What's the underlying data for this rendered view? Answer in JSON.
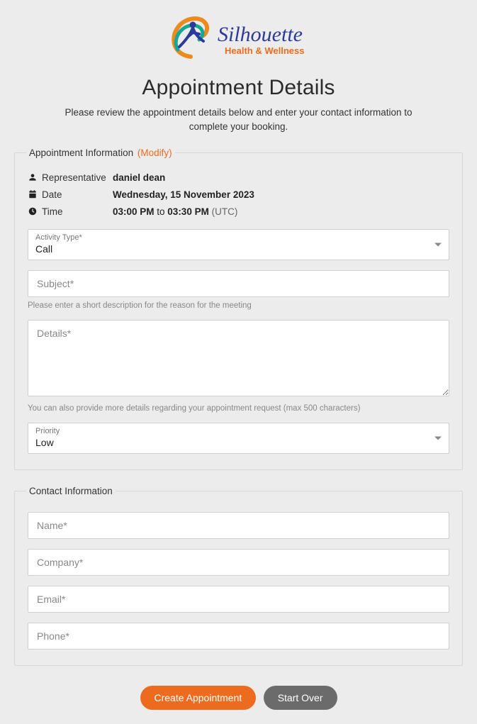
{
  "brand": {
    "name": "Silhouette",
    "tagline": "Health & Wellness"
  },
  "page": {
    "title": "Appointment Details",
    "subtitle": "Please review the appointment details below and enter your contact information to complete your booking."
  },
  "appointment_info": {
    "legend": "Appointment Information",
    "modify_link": "(Modify)",
    "representative_label": "Representative",
    "representative_value": "daniel dean",
    "date_label": "Date",
    "date_value": "Wednesday, 15 November 2023",
    "time_label": "Time",
    "time_start": "03:00 PM",
    "time_to": " to ",
    "time_end": "03:30 PM",
    "time_tz": " (UTC)"
  },
  "activity_type": {
    "label": "Activity Type*",
    "value": "Call"
  },
  "subject": {
    "placeholder": "Subject*",
    "helper": "Please enter a short description for the reason for the meeting"
  },
  "details": {
    "placeholder": "Details*",
    "helper": "You can also provide more details regarding your appointment request (max 500 characters)"
  },
  "priority": {
    "label": "Priority",
    "value": "Low"
  },
  "contact": {
    "legend": "Contact Information",
    "name_placeholder": "Name*",
    "company_placeholder": "Company*",
    "email_placeholder": "Email*",
    "phone_placeholder": "Phone*"
  },
  "actions": {
    "create": "Create Appointment",
    "start_over": "Start Over"
  }
}
